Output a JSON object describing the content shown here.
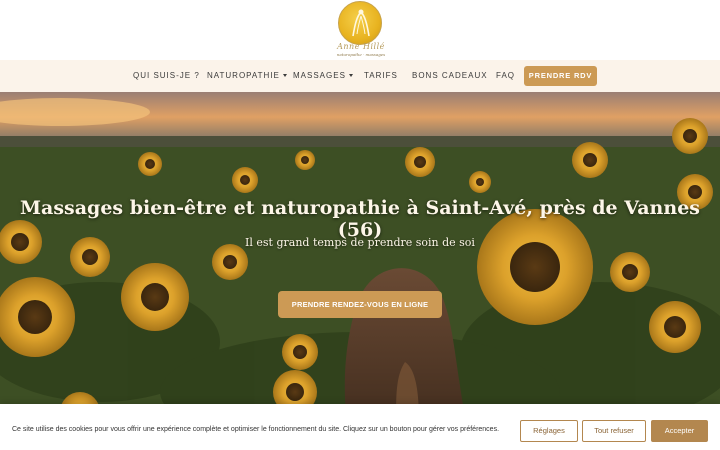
{
  "logo": {
    "name": "Anne Hillé",
    "tagline": "naturopathe · massages",
    "colors": {
      "gold": "#e8b320",
      "text": "#b59a5a"
    }
  },
  "nav": {
    "items": [
      {
        "label": "QUI SUIS-JE ?",
        "dropdown": false
      },
      {
        "label": "NATUROPATHIE",
        "dropdown": true
      },
      {
        "label": "MASSAGES",
        "dropdown": true
      },
      {
        "label": "TARIFS",
        "dropdown": false
      },
      {
        "label": "BONS CADEAUX",
        "dropdown": false
      },
      {
        "label": "FAQ",
        "dropdown": false
      }
    ],
    "cta_label": "PRENDRE RDV",
    "colors": {
      "background": "#fbf3ea",
      "accent": "#cc9a55"
    }
  },
  "hero": {
    "title": "Massages bien-être et naturopathie à Saint-Avé, près de Vannes (56)",
    "subtitle": "Il est grand temps de prendre soin de soi",
    "cta_label": "PRENDRE RENDEZ-VOUS EN LIGNE",
    "image": "sunflower-field-woman"
  },
  "cookie_banner": {
    "text": "Ce site utilise des cookies pour vous offrir une expérience complète et optimiser le fonctionnement du site. Cliquez sur un bouton pour gérer vos préférences.",
    "settings_label": "Réglages",
    "refuse_label": "Tout refuser",
    "accept_label": "Accepter",
    "colors": {
      "accent": "#b3874f"
    }
  }
}
